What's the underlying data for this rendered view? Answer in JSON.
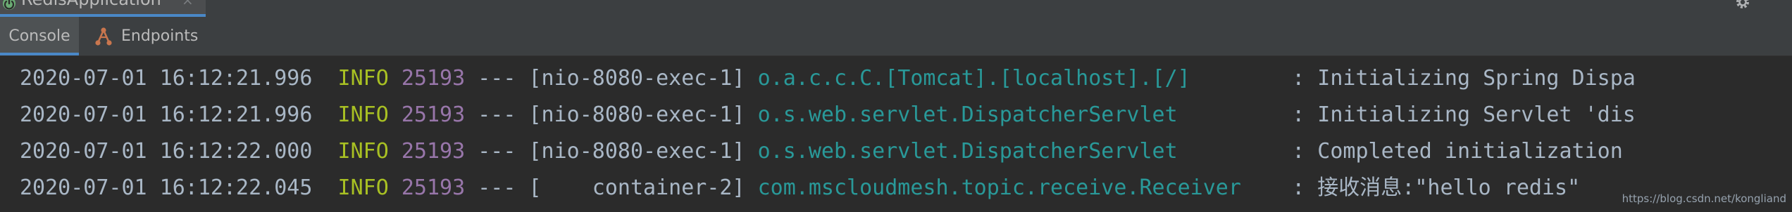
{
  "run_window": {
    "tab_title": "RedisApplication",
    "close_glyph": "×",
    "icons": [
      "spring-boot-app-icon",
      "close-icon",
      "gear-icon"
    ]
  },
  "tool_tabs": [
    {
      "label": "Console",
      "active": true
    },
    {
      "label": "Endpoints",
      "icon": "endpoints-icon",
      "active": false
    }
  ],
  "console": {
    "lines": [
      {
        "timestamp": "2020-07-01 16:12:21.996",
        "level": "INFO",
        "pid": "25193",
        "separator": "---",
        "thread": "[nio-8080-exec-1]",
        "logger": "o.a.c.c.C.[Tomcat].[localhost].[/]       ",
        "message": ": Initializing Spring Dispa"
      },
      {
        "timestamp": "2020-07-01 16:12:21.996",
        "level": "INFO",
        "pid": "25193",
        "separator": "---",
        "thread": "[nio-8080-exec-1]",
        "logger": "o.s.web.servlet.DispatcherServlet        ",
        "message": ": Initializing Servlet 'dis"
      },
      {
        "timestamp": "2020-07-01 16:12:22.000",
        "level": "INFO",
        "pid": "25193",
        "separator": "---",
        "thread": "[nio-8080-exec-1]",
        "logger": "o.s.web.servlet.DispatcherServlet        ",
        "message": ": Completed initialization "
      },
      {
        "timestamp": "2020-07-01 16:12:22.045",
        "level": "INFO",
        "pid": "25193",
        "separator": "---",
        "thread": "[    container-2]",
        "logger": "com.mscloudmesh.topic.receive.Receiver   ",
        "message": ": 接收消息:\"hello redis\""
      }
    ]
  },
  "watermark": "https://blog.csdn.net/kongliand",
  "colors": {
    "background": "#2b2b2b",
    "panel": "#3c3f41",
    "active_tab_underline": "#4a88c7",
    "text": "#a9b7c6",
    "level_info": "#a8c023",
    "pid": "#9876aa",
    "logger": "#299999"
  }
}
